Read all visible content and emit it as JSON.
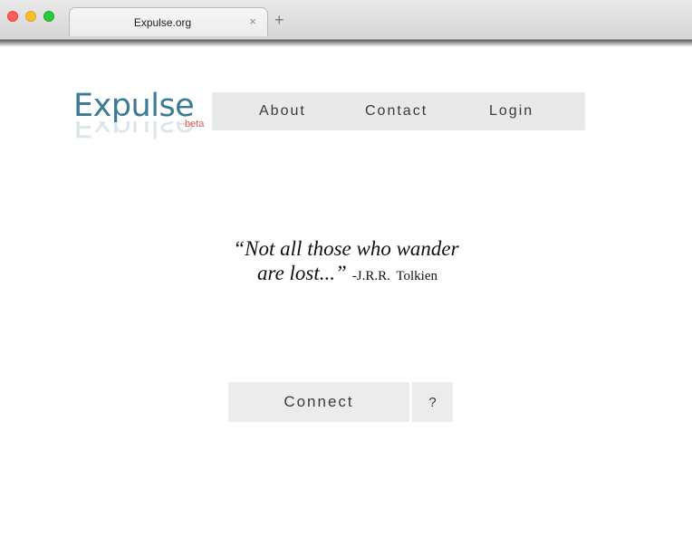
{
  "browser": {
    "tab_title": "Expulse.org",
    "tab_close": "×",
    "new_tab": "+"
  },
  "header": {
    "logo": "Expulse",
    "beta_label": "beta",
    "nav": {
      "about": "About",
      "contact": "Contact",
      "login": "Login"
    }
  },
  "quote": {
    "line1": "“Not all those who wander",
    "line2": "are lost...”",
    "author": "-J.R.R. Tolkien"
  },
  "actions": {
    "connect_label": "Connect",
    "help_label": "?"
  },
  "colors": {
    "logo": "#3d7a94",
    "beta": "#e35b5b",
    "nav_bg": "#e9e9e9",
    "button_bg": "#ececec"
  }
}
